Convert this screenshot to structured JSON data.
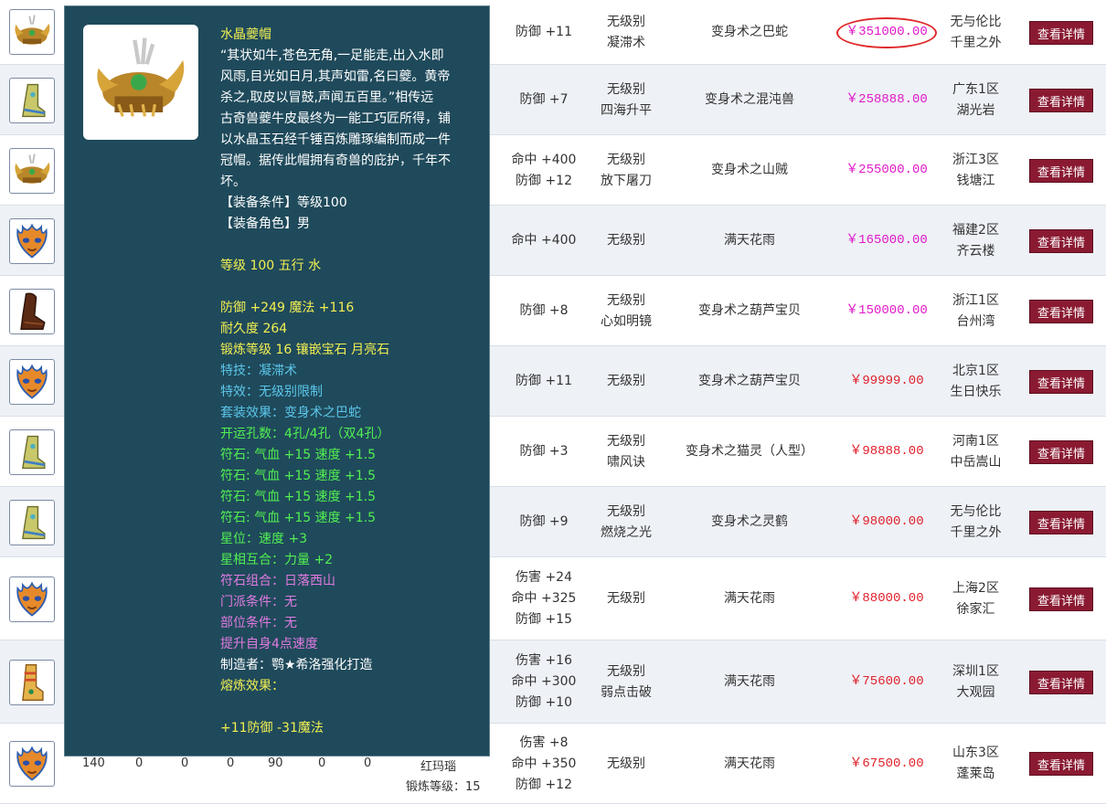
{
  "colors": {
    "button": "#8a1a32",
    "price_magenta": "#e018c8",
    "price_red": "#e0202a",
    "tooltip_bg": "#1f4a5b",
    "row_alt": "#eef1f6"
  },
  "detail_button_label": "查看详情",
  "rows": [
    {
      "icon": "helmet-icon",
      "attrs": [
        "防御 +11"
      ],
      "skill": [
        "无级别",
        "凝滞术"
      ],
      "set": "变身术之巴蛇",
      "price": "￥351000.00",
      "price_color": "magenta",
      "circled": true,
      "server": [
        "无与伦比",
        "千里之外"
      ]
    },
    {
      "icon": "boots-icon",
      "attrs": [
        "防御 +7"
      ],
      "skill": [
        "无级别",
        "四海升平"
      ],
      "set": "变身术之混沌兽",
      "price": "￥258888.00",
      "price_color": "magenta",
      "circled": false,
      "server": [
        "广东1区",
        "湖光岩"
      ]
    },
    {
      "icon": "helmet-icon",
      "attrs": [
        "命中 +400",
        "防御 +12"
      ],
      "skill": [
        "无级别",
        "放下屠刀"
      ],
      "set": "变身术之山贼",
      "price": "￥255000.00",
      "price_color": "magenta",
      "circled": false,
      "server": [
        "浙江3区",
        "钱塘江"
      ]
    },
    {
      "icon": "mask-icon",
      "attrs": [
        "命中 +400"
      ],
      "skill": [
        "无级别"
      ],
      "set": "满天花雨",
      "price": "￥165000.00",
      "price_color": "magenta",
      "circled": false,
      "server": [
        "福建2区",
        "齐云楼"
      ]
    },
    {
      "icon": "dark-boots-icon",
      "attrs": [
        "防御 +8"
      ],
      "skill": [
        "无级别",
        "心如明镜"
      ],
      "set": "变身术之葫芦宝贝",
      "price": "￥150000.00",
      "price_color": "magenta",
      "circled": false,
      "server": [
        "浙江1区",
        "台州湾"
      ]
    },
    {
      "icon": "mask-icon",
      "attrs": [
        "防御 +11"
      ],
      "skill": [
        "无级别"
      ],
      "set": "变身术之葫芦宝贝",
      "price": "￥99999.00",
      "price_color": "red",
      "circled": false,
      "server": [
        "北京1区",
        "生日快乐"
      ]
    },
    {
      "icon": "boots-icon",
      "attrs": [
        "防御 +3"
      ],
      "skill": [
        "无级别",
        "啸风诀"
      ],
      "set": "变身术之猫灵（人型）",
      "price": "￥98888.00",
      "price_color": "red",
      "circled": false,
      "server": [
        "河南1区",
        "中岳嵩山"
      ]
    },
    {
      "icon": "boots-icon",
      "attrs": [
        "防御 +9"
      ],
      "skill": [
        "无级别",
        "燃烧之光"
      ],
      "set": "变身术之灵鹤",
      "price": "￥98000.00",
      "price_color": "red",
      "circled": false,
      "server": [
        "无与伦比",
        "千里之外"
      ]
    },
    {
      "icon": "mask-icon",
      "attrs": [
        "伤害 +24",
        "命中 +325",
        "防御 +15"
      ],
      "skill": [
        "无级别"
      ],
      "set": "满天花雨",
      "price": "￥88000.00",
      "price_color": "red",
      "circled": false,
      "server": [
        "上海2区",
        "徐家汇"
      ]
    },
    {
      "icon": "gold-boots-icon",
      "attrs": [
        "伤害 +16",
        "命中 +300",
        "防御 +10"
      ],
      "skill": [
        "无级别",
        "弱点击破"
      ],
      "set": "满天花雨",
      "price": "￥75600.00",
      "price_color": "red",
      "circled": false,
      "server": [
        "深圳1区",
        "大观园"
      ]
    },
    {
      "icon": "mask-icon",
      "attrs": [
        "伤害 +8",
        "命中 +350",
        "防御 +12"
      ],
      "skill": [
        "无级别"
      ],
      "set": "满天花雨",
      "price": "￥67500.00",
      "price_color": "red",
      "circled": false,
      "server": [
        "山东3区",
        "蓬莱岛"
      ]
    }
  ],
  "last_row_partial": {
    "nums": [
      "140",
      "0",
      "0",
      "0",
      "90",
      "0",
      "0"
    ],
    "gem": "红玛瑙",
    "forge": "锻炼等级：15"
  },
  "tooltip": {
    "lines": [
      {
        "t": "水晶夔帽",
        "c": "y"
      },
      {
        "t": "“其状如牛,苍色无角,一足能走,出入水即",
        "c": "w"
      },
      {
        "t": "风雨,目光如日月,其声如雷,名曰夔。黄帝",
        "c": "w"
      },
      {
        "t": "杀之,取皮以冒鼓,声闻五百里。”相传远",
        "c": "w"
      },
      {
        "t": "古奇兽夔牛皮最终为一能工巧匠所得，铺",
        "c": "w"
      },
      {
        "t": "以水晶玉石经千锤百炼雕琢编制而成一件",
        "c": "w"
      },
      {
        "t": "冠帽。据传此帽拥有奇兽的庇护，千年不",
        "c": "w"
      },
      {
        "t": "坏。",
        "c": "w"
      },
      {
        "t": "【装备条件】等级100",
        "c": "w"
      },
      {
        "t": "【装备角色】男",
        "c": "w"
      },
      {
        "t": "",
        "c": "w"
      },
      {
        "t": "等级 100 五行 水",
        "c": "y"
      },
      {
        "t": "",
        "c": "w"
      },
      {
        "t": "防御 +249 魔法 +116",
        "c": "y"
      },
      {
        "t": "耐久度 264",
        "c": "y"
      },
      {
        "t": "锻炼等级 16 镶嵌宝石 月亮石",
        "c": "y"
      },
      {
        "t": "特技：凝滞术",
        "c": "b"
      },
      {
        "t": "特效：无级别限制",
        "c": "b"
      },
      {
        "t": "套装效果：变身术之巴蛇",
        "c": "b"
      },
      {
        "t": "开运孔数：4孔/4孔（双4孔）",
        "c": "g"
      },
      {
        "t": "符石: 气血 +15 速度 +1.5",
        "c": "g"
      },
      {
        "t": "符石: 气血 +15 速度 +1.5",
        "c": "g"
      },
      {
        "t": "符石: 气血 +15 速度 +1.5",
        "c": "g"
      },
      {
        "t": "符石: 气血 +15 速度 +1.5",
        "c": "g"
      },
      {
        "t": "星位：速度 +3",
        "c": "g"
      },
      {
        "t": "星相互合：力量 +2",
        "c": "g"
      },
      {
        "t": "符石组合：日落西山",
        "c": "p"
      },
      {
        "t": "门派条件：无",
        "c": "p"
      },
      {
        "t": "部位条件：无",
        "c": "p"
      },
      {
        "t": "提升自身4点速度",
        "c": "p"
      },
      {
        "t": "制造者：鹗★希洛强化打造",
        "c": "w"
      },
      {
        "t": "熔炼效果：",
        "c": "y"
      },
      {
        "t": "",
        "c": "w"
      },
      {
        "t": "+11防御 -31魔法",
        "c": "y"
      }
    ]
  }
}
